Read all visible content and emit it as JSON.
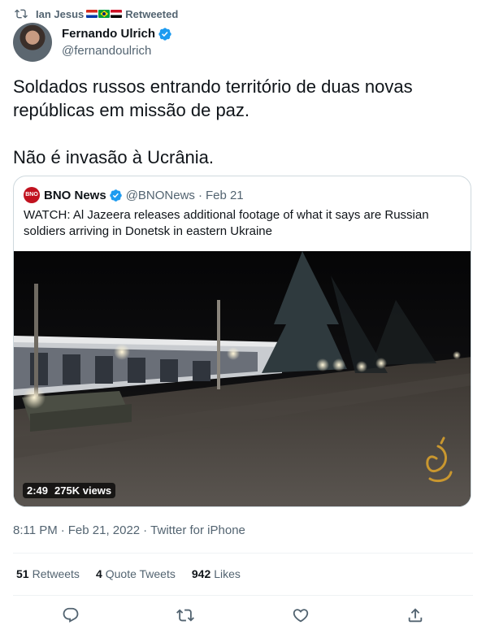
{
  "retweet": {
    "user": "Ian Jesus",
    "flags": [
      "flag-paraguay-icon",
      "flag-brazil-icon",
      "flag-egypt-icon"
    ],
    "label": "Retweeted"
  },
  "author": {
    "name": "Fernando Ulrich",
    "handle": "@fernandoulrich"
  },
  "tweet": {
    "text": "Soldados russos entrando território de duas novas\nrepúblicas em missão de paz.\n\nNão é invasão à Ucrânia."
  },
  "quote": {
    "logo_text": "BNO",
    "name": "BNO News",
    "handle": "@BNONews",
    "separator": "·",
    "date": "Feb 21",
    "text": "WATCH: Al Jazeera releases additional footage of what it says are Russian soldiers arriving in Donetsk in eastern Ukraine",
    "video": {
      "duration": "2:49",
      "views": "275K views"
    }
  },
  "meta": {
    "time": "8:11 PM",
    "date": "Feb 21, 2022",
    "source": "Twitter for iPhone",
    "sep": "·"
  },
  "stats": {
    "retweets_count": "51",
    "retweets_label": "Retweets",
    "quotes_count": "4",
    "quotes_label": "Quote Tweets",
    "likes_count": "942",
    "likes_label": "Likes"
  },
  "colors": {
    "text": "#0f1419",
    "secondary": "#536471",
    "verified": "#1d9bf0",
    "border": "#cfd9de"
  }
}
